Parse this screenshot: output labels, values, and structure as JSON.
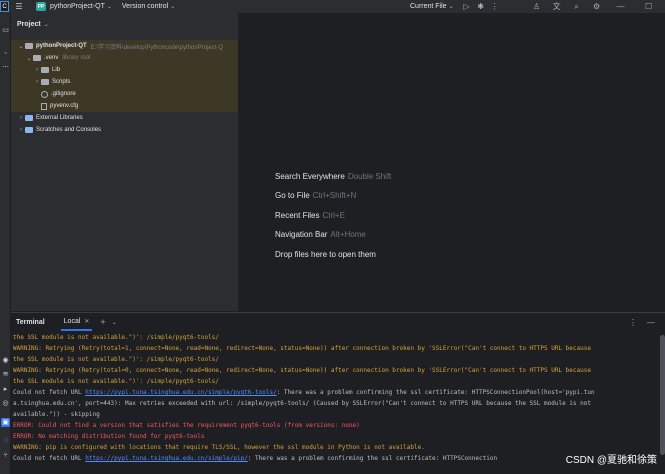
{
  "titlebar": {
    "app_mark": "C",
    "project_badge": "PP",
    "project_name": "pythonProject-QT",
    "vcs": "Version control",
    "run_config": "Current File"
  },
  "project_panel": {
    "title": "Project",
    "tree": [
      {
        "label": "pythonProject-QT",
        "path": "E:\\学习资料\\develop\\Pythoncode\\pythonProject-Q"
      },
      {
        "label": ".venv",
        "note": "library root"
      },
      {
        "label": "Lib"
      },
      {
        "label": "Scripts"
      },
      {
        "label": ".gitignore"
      },
      {
        "label": "pyvenv.cfg"
      },
      {
        "label": "External Libraries"
      },
      {
        "label": "Scratches and Consoles"
      }
    ]
  },
  "welcome": [
    {
      "label": "Search Everywhere",
      "shortcut": "Double Shift"
    },
    {
      "label": "Go to File",
      "shortcut": "Ctrl+Shift+N"
    },
    {
      "label": "Recent Files",
      "shortcut": "Ctrl+E"
    },
    {
      "label": "Navigation Bar",
      "shortcut": "Alt+Home"
    },
    {
      "label": "Drop files here to open them",
      "shortcut": ""
    }
  ],
  "terminal": {
    "title": "Terminal",
    "tab": "Local",
    "lines": [
      {
        "type": "warn",
        "text": "the SSL module is not available.\")': /simple/pyqt6-tools/"
      },
      {
        "type": "warn",
        "text": "WARNING: Retrying (Retry(total=1, connect=None, read=None, redirect=None, status=None)) after connection broken by 'SSLError(\"Can't connect to HTTPS URL because"
      },
      {
        "type": "warn",
        "text": "the SSL module is not available.\")': /simple/pyqt6-tools/"
      },
      {
        "type": "warn",
        "text": "WARNING: Retrying (Retry(total=0, connect=None, read=None, redirect=None, status=None)) after connection broken by 'SSLError(\"Can't connect to HTTPS URL because"
      },
      {
        "type": "warn",
        "text": "the SSL module is not available.\")': /simple/pyqt6-tools/"
      },
      {
        "type": "norm",
        "pre": "Could not fetch URL ",
        "link": "https://pypi.tuna.tsinghua.edu.cn/simple/pyqt6-tools/",
        "post": ": There was a problem confirming the ssl certificate: HTTPSConnectionPool(host='pypi.tun"
      },
      {
        "type": "norm",
        "text": "a.tsinghua.edu.cn', port=443): Max retries exceeded with url: /simple/pyqt6-tools/ (Caused by SSLError(\"Can't connect to HTTPS URL because the SSL module is not"
      },
      {
        "type": "norm",
        "text": "available.\")) - skipping"
      },
      {
        "type": "err",
        "text": "ERROR: Could not find a version that satisfies the requirement pyqt6-tools (from versions: none)"
      },
      {
        "type": "err",
        "text": "ERROR: No matching distribution found for pyqt6-tools"
      },
      {
        "type": "warn",
        "text": "WARNING: pip is configured with locations that require TLS/SSL, however the ssl module in Python is not available."
      },
      {
        "type": "norm",
        "pre": "Could not fetch URL ",
        "link": "https://pypi.tuna.tsinghua.edu.cn/simple/pip/",
        "post": ": There was a problem confirming the ssl certificate: HTTPSConnection"
      }
    ]
  },
  "watermark": "CSDN @夏驰和徐策"
}
